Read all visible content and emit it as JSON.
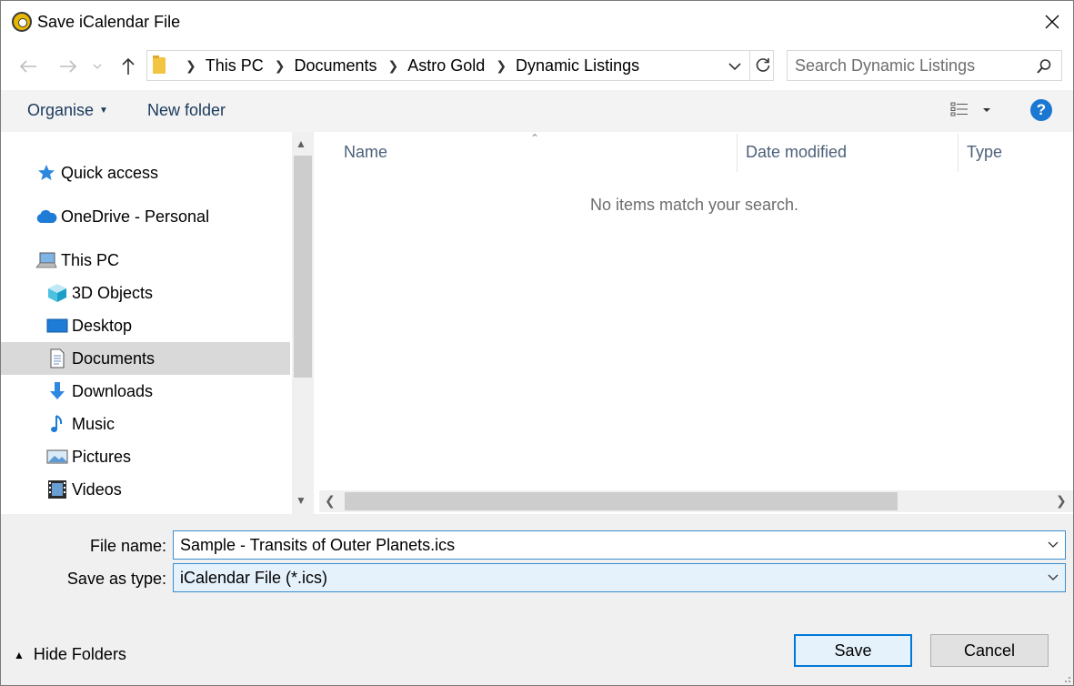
{
  "window": {
    "title": "Save iCalendar File"
  },
  "nav": {
    "address": {
      "crumbs": [
        "This PC",
        "Documents",
        "Astro Gold",
        "Dynamic Listings"
      ]
    },
    "search": {
      "placeholder": "Search Dynamic Listings"
    }
  },
  "toolbar": {
    "organise_label": "Organise",
    "new_folder_label": "New folder",
    "help_label": "?"
  },
  "sidebar": {
    "items": [
      {
        "label": "Quick access",
        "icon": "star-icon"
      },
      {
        "label": "OneDrive - Personal",
        "icon": "cloud-icon"
      },
      {
        "label": "This PC",
        "icon": "computer-icon"
      },
      {
        "label": "3D Objects",
        "icon": "cube-icon"
      },
      {
        "label": "Desktop",
        "icon": "desktop-icon"
      },
      {
        "label": "Documents",
        "icon": "document-icon",
        "selected": true
      },
      {
        "label": "Downloads",
        "icon": "download-icon"
      },
      {
        "label": "Music",
        "icon": "music-icon"
      },
      {
        "label": "Pictures",
        "icon": "pictures-icon"
      },
      {
        "label": "Videos",
        "icon": "videos-icon"
      }
    ]
  },
  "content": {
    "columns": [
      "Name",
      "Date modified",
      "Type"
    ],
    "empty_message": "No items match your search."
  },
  "form": {
    "file_name_label": "File name:",
    "file_name_value": "Sample - Transits of Outer Planets.ics",
    "save_type_label": "Save as type:",
    "save_type_value": "iCalendar File (*.ics)"
  },
  "footer": {
    "hide_folders_label": "Hide Folders",
    "save_label": "Save",
    "cancel_label": "Cancel"
  },
  "colors": {
    "accent": "#0078d7",
    "help": "#1a78d1",
    "link_text": "#1a3a5c"
  }
}
